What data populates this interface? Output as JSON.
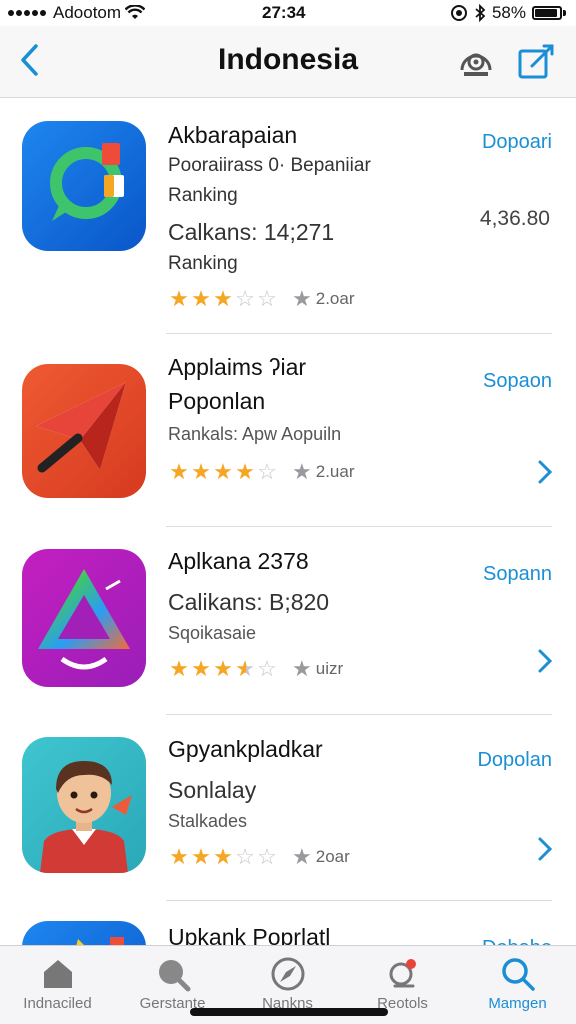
{
  "status_bar": {
    "carrier": "Adootom",
    "time": "27:34",
    "battery": "58%"
  },
  "nav": {
    "title": "Indonesia",
    "back_icon": "chevron-left-icon",
    "profile_icon": "profile-icon",
    "compose_icon": "compose-icon",
    "accent_color": "#1a8fd6"
  },
  "apps": [
    {
      "name": "Akbarapaian",
      "line1": "Pooraiirass 0· Bepaniiar",
      "line2": "Ranking",
      "line3": "Calkans: 14;271",
      "line4": "Ranking",
      "stars": 3,
      "rating_count": "2.oar",
      "get_label": "Dopoari",
      "price": "4,36.80",
      "icon": "green-chat-icon"
    },
    {
      "name": "Applaims ʔiar",
      "name2": "Poponlan",
      "line1": "Rankals: Apw Aopuiln",
      "stars": 4,
      "rating_count": "2.uar",
      "get_label": "Sopaon",
      "icon": "paper-plane-icon"
    },
    {
      "name": "Aplkana 2378",
      "line1": "Calikans: B;820",
      "line2": "Sqoikasaie",
      "stars": 3.5,
      "rating_count": "uizr",
      "get_label": "Sopann",
      "icon": "rainbow-triangle-icon"
    },
    {
      "name": "Gpyankpladkar",
      "line1": "Sonlalay",
      "line2": "Stalkades",
      "stars": 3,
      "rating_count": "2oar",
      "get_label": "Dopolan",
      "icon": "cartoon-boy-icon"
    },
    {
      "name": "Upkank Poprlatl",
      "get_label": "Dobabo",
      "icon": "blue-app-icon"
    }
  ],
  "tabs": [
    {
      "label": "Indnaciled",
      "icon": "home-icon",
      "active": false
    },
    {
      "label": "Gerstante",
      "icon": "search-globe-icon",
      "active": false
    },
    {
      "label": "Nankns",
      "icon": "compass-icon",
      "active": false
    },
    {
      "label": "Reotols",
      "icon": "notifications-icon",
      "active": false
    },
    {
      "label": "Mamgen",
      "icon": "search-icon",
      "active": true
    }
  ]
}
